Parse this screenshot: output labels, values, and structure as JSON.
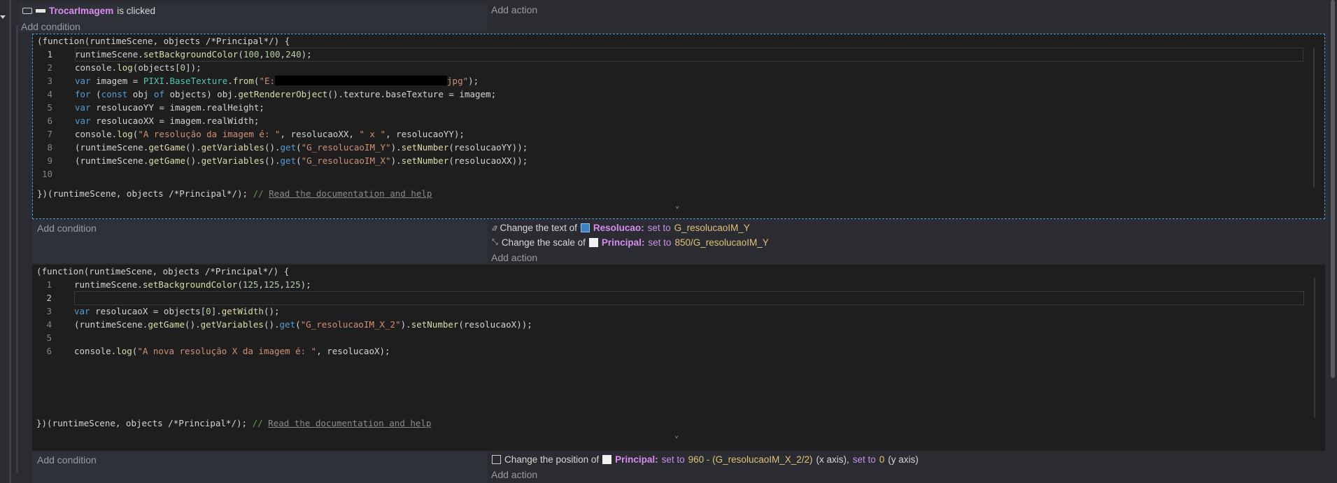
{
  "event": {
    "condition_object": "TrocarImagem",
    "condition_suffix": "is clicked",
    "add_condition": "Add condition",
    "add_action": "Add action"
  },
  "code1": {
    "header": "(function(runtimeScene, objects /*Principal*/) {",
    "footer": "})(runtimeScene, objects /*Principal*/); ",
    "footer_comment": "// ",
    "footer_link": "Read the documentation and help",
    "line_numbers": [
      "1",
      "2",
      "3",
      "4",
      "5",
      "6",
      "7",
      "8",
      "9",
      "10"
    ]
  },
  "sub1": {
    "add_condition": "Add condition",
    "action1_prefix": "Change the text of",
    "action1_object": "Resolucao:",
    "action1_set": "set to",
    "action1_value": "G_resolucaoIM_Y",
    "action2_prefix": "Change the scale of",
    "action2_object": "Principal:",
    "action2_set": "set to",
    "action2_value": "850/G_resolucaoIM_Y",
    "add_action": "Add action"
  },
  "code2": {
    "header": "(function(runtimeScene, objects /*Principal*/) {",
    "footer": "})(runtimeScene, objects /*Principal*/); ",
    "footer_comment": "// ",
    "footer_link": "Read the documentation and help",
    "line_numbers": [
      "1",
      "2",
      "3",
      "4",
      "5",
      "6"
    ]
  },
  "sub2": {
    "add_condition": "Add condition",
    "action_prefix": "Change the position of",
    "action_object": "Principal:",
    "action_set1": "set to",
    "action_value1": "960 - (G_resolucaoIM_X_2/2)",
    "action_axis1": "(x axis),",
    "action_set2": "set to",
    "action_value2": "0",
    "action_axis2": "(y axis)",
    "add_action": "Add action"
  },
  "colors": {
    "background": "#2b2c31",
    "code_background": "#1e1e1e",
    "object_name": "#d98cef",
    "selection_outline": "#4a9fd8"
  }
}
